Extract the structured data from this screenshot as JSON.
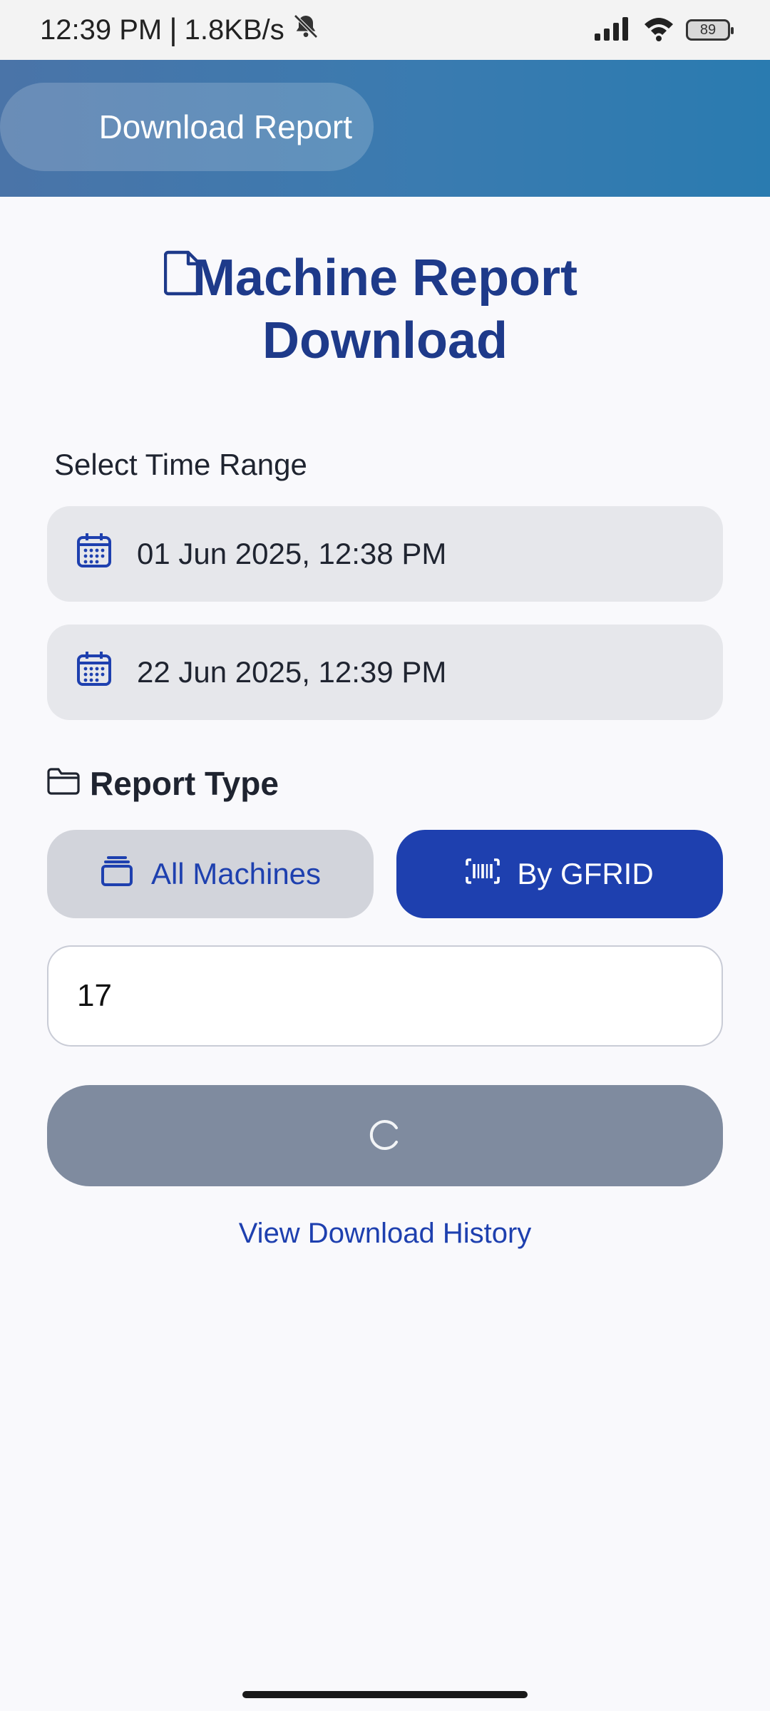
{
  "status_bar": {
    "time": "12:39 PM",
    "separator": "|",
    "network_speed": "1.8KB/s",
    "battery_level": "89",
    "icons": [
      "bell-off-icon",
      "signal-icon",
      "wifi-icon",
      "battery-icon"
    ]
  },
  "header": {
    "title": "Download Report"
  },
  "page": {
    "title_line1": "Machine Report",
    "title_line2": "Download",
    "title_icon": "document-icon"
  },
  "time_range": {
    "label": "Select Time Range",
    "start": "01 Jun 2025, 12:38 PM",
    "end": "22 Jun 2025, 12:39 PM"
  },
  "report_type": {
    "label": "Report Type",
    "options": [
      {
        "label": "All Machines",
        "icon": "stack-icon",
        "selected": false
      },
      {
        "label": "By GFRID",
        "icon": "barcode-icon",
        "selected": true
      }
    ]
  },
  "gfrid_input": {
    "value": "17"
  },
  "submit": {
    "state": "loading"
  },
  "history_link": "View Download History",
  "colors": {
    "primary": "#1e40af",
    "title": "#1e3a8a",
    "field_bg": "#e6e7eb",
    "button_disabled": "#7f8b9f"
  }
}
